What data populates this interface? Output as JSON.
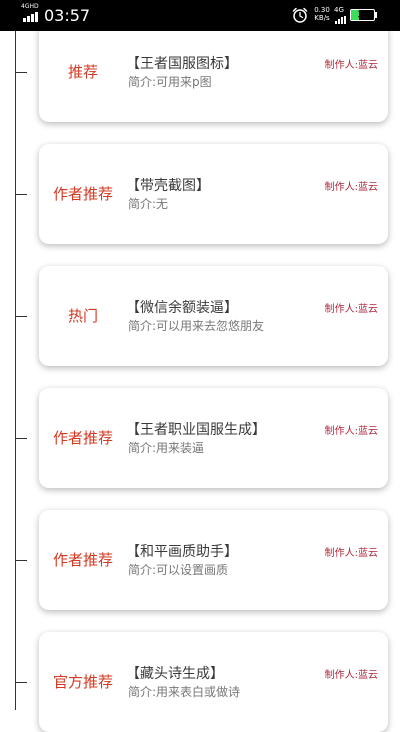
{
  "status_bar": {
    "network_label": "4GHD",
    "time": "03:57",
    "speed_value": "0.30",
    "speed_unit": "KB/s",
    "network_type": "4G",
    "battery_level": "35",
    "alarm_icon": "alarm-clock-icon"
  },
  "colors": {
    "tag": "#d33a22",
    "author": "#b0283e",
    "title": "#3a3a3a",
    "desc": "#777777"
  },
  "cards": [
    {
      "tag": "推荐",
      "title": "【王者国服图标】",
      "desc": "简介:可用来p图",
      "author": "制作人:蓝云"
    },
    {
      "tag": "作者推荐",
      "title": "【带壳截图】",
      "desc": "简介:无",
      "author": "制作人:蓝云"
    },
    {
      "tag": "热门",
      "title": "【微信余额装逼】",
      "desc": "简介:可以用来去忽悠朋友",
      "author": "制作人:蓝云"
    },
    {
      "tag": "作者推荐",
      "title": "【王者职业国服生成】",
      "desc": "简介:用来装逼",
      "author": "制作人:蓝云"
    },
    {
      "tag": "作者推荐",
      "title": "【和平画质助手】",
      "desc": "简介:可以设置画质",
      "author": "制作人:蓝云"
    },
    {
      "tag": "官方推荐",
      "title": "【藏头诗生成】",
      "desc": "简介:用来表白或做诗",
      "author": "制作人:蓝云"
    }
  ]
}
